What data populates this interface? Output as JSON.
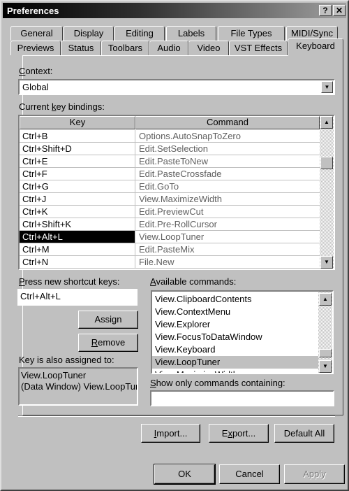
{
  "window": {
    "title": "Preferences",
    "help": "?",
    "close": "✕"
  },
  "tabs_row1": [
    "General",
    "Display",
    "Editing",
    "Labels",
    "File Types",
    "MIDI/Sync"
  ],
  "tabs_row2": [
    "Previews",
    "Status",
    "Toolbars",
    "Audio",
    "Video",
    "VST Effects",
    "Keyboard"
  ],
  "active_tab": "Keyboard",
  "context": {
    "label_u": "C",
    "label": "ontext:",
    "value": "Global"
  },
  "bindings": {
    "label_pre": "Current ",
    "label_u": "k",
    "label_post": "ey bindings:",
    "col_key": "Key",
    "col_command": "Command",
    "rows": [
      [
        "Ctrl+B",
        "Options.AutoSnapToZero"
      ],
      [
        "Ctrl+Shift+D",
        "Edit.SetSelection"
      ],
      [
        "Ctrl+E",
        "Edit.PasteToNew"
      ],
      [
        "Ctrl+F",
        "Edit.PasteCrossfade"
      ],
      [
        "Ctrl+G",
        "Edit.GoTo"
      ],
      [
        "Ctrl+J",
        "View.MaximizeWidth"
      ],
      [
        "Ctrl+K",
        "Edit.PreviewCut"
      ],
      [
        "Ctrl+Shift+K",
        "Edit.Pre-RollCursor"
      ],
      [
        "Ctrl+Alt+L",
        "View.LoopTuner"
      ],
      [
        "Ctrl+M",
        "Edit.PasteMix"
      ],
      [
        "Ctrl+N",
        "File.New"
      ]
    ],
    "selected_index": 8
  },
  "shortcut": {
    "label_u": "P",
    "label": "ress new shortcut keys:",
    "value": "Ctrl+Alt+L"
  },
  "assign": {
    "pre": "Assi",
    "u": "g",
    "post": "n"
  },
  "remove": {
    "u": "R",
    "post": "emove"
  },
  "also": {
    "label": "Key is also assigned to:",
    "lines": [
      "View.LoopTuner",
      "(Data Window) View.LoopTun"
    ]
  },
  "available": {
    "label_u": "A",
    "label": "vailable commands:",
    "items": [
      "View.ClipboardContents",
      "View.ContextMenu",
      "View.Explorer",
      "View.FocusToDataWindow",
      "View.Keyboard",
      "View.LoopTuner",
      "View.MaximizeWidth"
    ],
    "selected_index": 5
  },
  "filter": {
    "label_u": "S",
    "label": "how only commands containing:",
    "value": ""
  },
  "import": {
    "u": "I",
    "post": "mport..."
  },
  "export": {
    "pre": "E",
    "u": "x",
    "post": "port..."
  },
  "default_all": "Default All",
  "ok": "OK",
  "cancel": "Cancel",
  "apply": "Apply"
}
